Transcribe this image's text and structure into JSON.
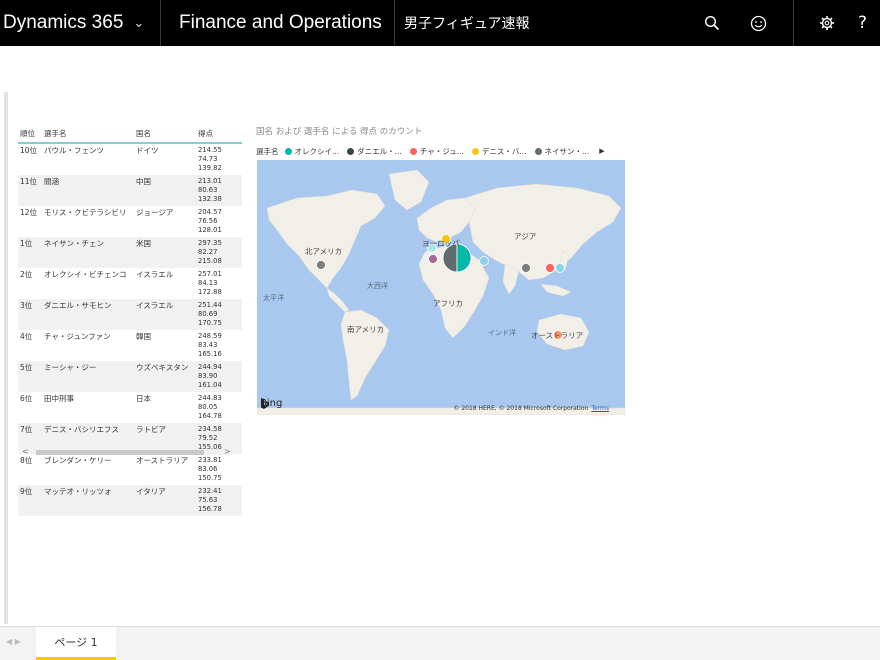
{
  "topbar": {
    "brand": "Dynamics 365",
    "module": "Finance and Operations",
    "page_name": "男子フィギュア速報"
  },
  "icons": {
    "search": "search-icon",
    "feedback": "smiley-icon",
    "settings": "gear-icon",
    "help": "help-icon"
  },
  "table": {
    "headers": [
      "順位",
      "選手名",
      "国名",
      "得点"
    ],
    "rows": [
      {
        "rank": "10位",
        "name": "パウル・フェンツ",
        "country": "ドイツ",
        "score": "214.55",
        "scores": "74.73 139.82"
      },
      {
        "rank": "11位",
        "name": "閻涵",
        "country": "中国",
        "score": "213.01",
        "scores": "80.63 132.38"
      },
      {
        "rank": "12位",
        "name": "モリス・クビテラシビリ",
        "country": "ジョージア",
        "score": "204.57",
        "scores": "76.56 128.01"
      },
      {
        "rank": "1位",
        "name": "ネイサン・チェン",
        "country": "米国",
        "score": "297.35",
        "scores": "82.27 215.08"
      },
      {
        "rank": "2位",
        "name": "オレクシイ・ビチェンコ",
        "country": "イスラエル",
        "score": "257.01",
        "scores": "84.13 172.88"
      },
      {
        "rank": "3位",
        "name": "ダニエル・サモヒン",
        "country": "イスラエル",
        "score": "251.44",
        "scores": "80.69 170.75"
      },
      {
        "rank": "4位",
        "name": "チャ・ジュンファン",
        "country": "韓国",
        "score": "248.59",
        "scores": "83.43 165.16"
      },
      {
        "rank": "5位",
        "name": "ミーシャ・ジー",
        "country": "ウズベキスタン",
        "score": "244.94",
        "scores": "83.90 161.04"
      },
      {
        "rank": "6位",
        "name": "田中刑事",
        "country": "日本",
        "score": "244.83",
        "scores": "80.05 164.78"
      },
      {
        "rank": "7位",
        "name": "デニス・バシリエフス",
        "country": "ラトビア",
        "score": "234.58",
        "scores": "79.52 155.06"
      },
      {
        "rank": "8位",
        "name": "ブレンダン・ケリー",
        "country": "オーストラリア",
        "score": "233.81",
        "scores": "83.06 150.75"
      },
      {
        "rank": "9位",
        "name": "マッテオ・リッツォ",
        "country": "イタリア",
        "score": "232.41",
        "scores": "75.63 156.78"
      }
    ]
  },
  "map": {
    "title": "国名 および 選手名 による 得点 のカウント",
    "legend_title": "選手名",
    "legend": [
      {
        "label": "オレクシイ...",
        "color": "#01b8aa"
      },
      {
        "label": "ダニエル・...",
        "color": "#374649"
      },
      {
        "label": "チャ・ジュ...",
        "color": "#fd625e"
      },
      {
        "label": "デニス・バ...",
        "color": "#f2c80f"
      },
      {
        "label": "ネイサン・...",
        "color": "#5f6b6d"
      }
    ],
    "labels": {
      "north_america": "北アメリカ",
      "europe": "ヨーロッパ",
      "asia": "アジア",
      "africa": "アフリカ",
      "south_america": "南アメリカ",
      "oceania": "オーストラリア",
      "pacific": "太平洋",
      "atlantic": "大西洋",
      "indian": "インド洋"
    },
    "bing": "Bing",
    "copyright": "© 2018 HERE, © 2018 Microsoft Corporation",
    "terms": "Terms"
  },
  "footer": {
    "page_tab": "ページ 1"
  }
}
